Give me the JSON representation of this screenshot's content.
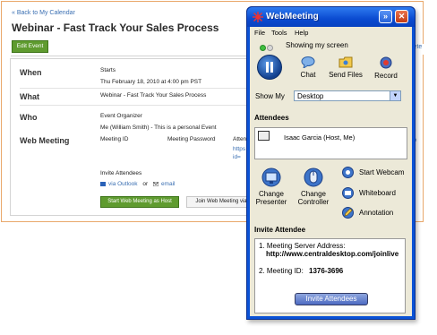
{
  "calendar": {
    "back_link": "« Back to My Calendar",
    "title": "Webinar - Fast Track Your Sales Process",
    "edit_button": "Edit Event",
    "when": {
      "label": "When",
      "starts_label": "Starts",
      "starts_value": "Thu February 18, 2010 at 4:00 pm PST"
    },
    "what": {
      "label": "What",
      "value": "Webinar - Fast Track Your Sales Process"
    },
    "who": {
      "label": "Who",
      "organizer_label": "Event Organizer",
      "organizer_value": "Me (William Smith) - This is a personal Event"
    },
    "web_meeting": {
      "label": "Web Meeting",
      "meeting_id_label": "Meeting ID",
      "meeting_password_label": "Meeting Password",
      "attendee_fragment": "Attend",
      "https_fragment": "https",
      "id_fragment": "id=",
      "invite_label": "Invite Attendees",
      "via_outlook": "via Outlook",
      "or_text": "or",
      "email": "email",
      "start_button": "Start Web Meeting as Host",
      "join_button": "Join Web Meeting via"
    },
    "tab_fragment": "lete",
    "ip_fragment": "lp"
  },
  "webmeeting": {
    "title": "WebMeeting",
    "menu": [
      "File",
      "Tools",
      "Help"
    ],
    "status": "Showing my screen",
    "tools": {
      "chat": "Chat",
      "send_files": "Send Files",
      "record": "Record"
    },
    "show_my_label": "Show My",
    "show_my_value": "Desktop",
    "attendees_heading": "Attendees",
    "attendee": "Isaac Garcia  (Host, Me)",
    "actions": {
      "change_presenter": "Change\nPresenter",
      "change_controller": "Change\nController",
      "start_webcam": "Start Webcam",
      "whiteboard": "Whiteboard",
      "annotation": "Annotation"
    },
    "invite_heading": "Invite Attendee",
    "invite": {
      "line1": "1. Meeting Server Address:",
      "line2": "http://www.centraldesktop.com/joinlive",
      "line3_label": "2. Meeting ID:",
      "line3_value": "1376-3696",
      "button": "Invite Attendees"
    },
    "colors": {
      "title_bar": "#0a52d6",
      "body": "#ece9d8",
      "status_green": "#3fbf3f"
    }
  }
}
